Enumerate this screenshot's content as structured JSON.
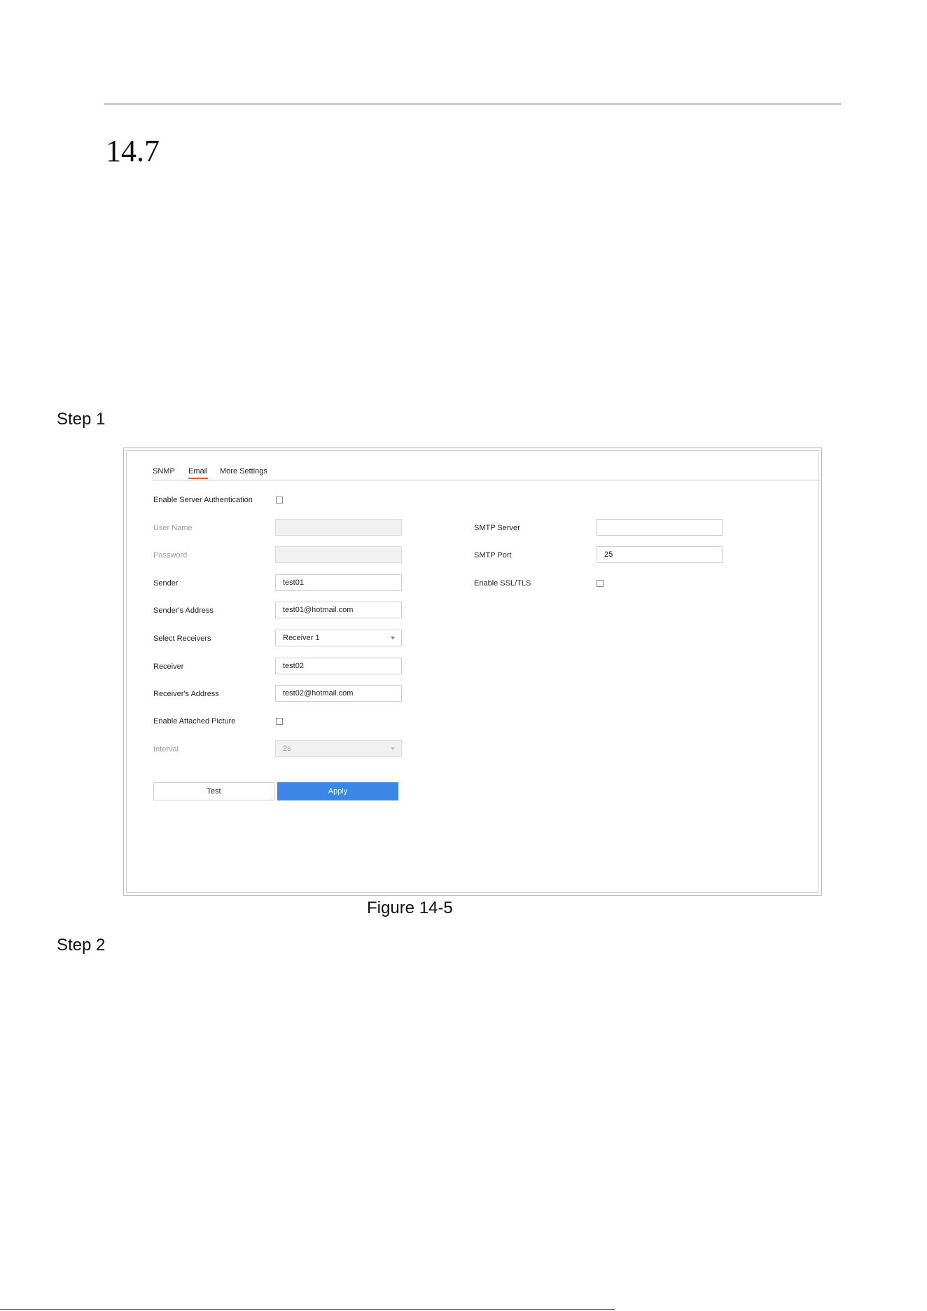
{
  "document": {
    "section_number": "14.7",
    "step1": "Step 1",
    "step2": "Step 2",
    "figure_caption": "Figure 14-5"
  },
  "tabs": [
    {
      "label": "SNMP",
      "active": false
    },
    {
      "label": "Email",
      "active": true
    },
    {
      "label": "More Settings",
      "active": false
    }
  ],
  "form": {
    "enable_server_auth": {
      "label": "Enable Server Authentication",
      "checked": false
    },
    "user_name": {
      "label": "User Name",
      "value": ""
    },
    "password": {
      "label": "Password",
      "value": ""
    },
    "sender": {
      "label": "Sender",
      "value": "test01"
    },
    "sender_address": {
      "label": "Sender's Address",
      "value": "test01@hotmail.com"
    },
    "select_receivers": {
      "label": "Select Receivers",
      "value": "Receiver 1"
    },
    "receiver": {
      "label": "Receiver",
      "value": "test02"
    },
    "receiver_address": {
      "label": "Receiver's Address",
      "value": "test02@hotmail.com"
    },
    "enable_attached_picture": {
      "label": "Enable Attached Picture",
      "checked": false
    },
    "interval": {
      "label": "Interval",
      "value": "2s"
    },
    "smtp_server": {
      "label": "SMTP Server",
      "value": ""
    },
    "smtp_port": {
      "label": "SMTP Port",
      "value": "25"
    },
    "enable_ssl": {
      "label": "Enable SSL/TLS",
      "checked": false
    }
  },
  "buttons": {
    "test": "Test",
    "apply": "Apply"
  },
  "colors": {
    "accent": "#3b86e6",
    "active_tab_underline": "#e05a2b"
  }
}
